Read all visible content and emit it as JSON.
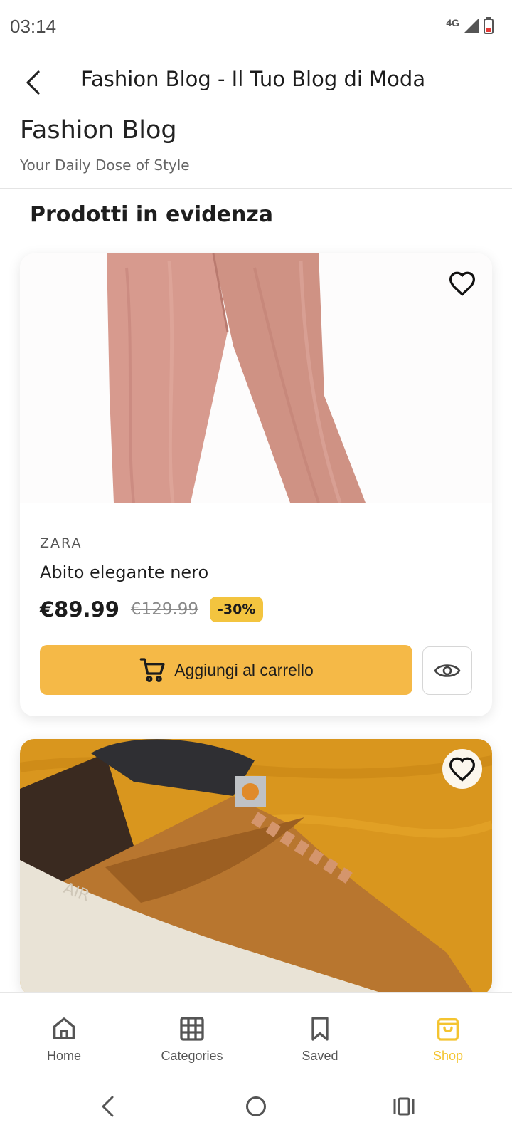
{
  "status_bar": {
    "time": "03:14",
    "network": "4G"
  },
  "app_bar": {
    "title": "Fashion Blog - Il Tuo Blog di Moda"
  },
  "blog": {
    "title": "Fashion Blog",
    "subtitle": "Your Daily Dose of Style"
  },
  "section": {
    "title": "Prodotti in evidenza"
  },
  "products": [
    {
      "brand": "ZARA",
      "name": "Abito elegante nero",
      "price": "€89.99",
      "old_price": "€129.99",
      "discount": "-30%",
      "add_to_cart_label": "Aggiungi al carrello"
    }
  ],
  "bottom_nav": {
    "items": [
      {
        "label": "Home",
        "icon": "home-icon"
      },
      {
        "label": "Categories",
        "icon": "grid-icon"
      },
      {
        "label": "Saved",
        "icon": "bookmark-icon"
      },
      {
        "label": "Shop",
        "icon": "shopping-bag-icon"
      }
    ],
    "active": "Shop"
  },
  "colors": {
    "accent": "#f4c430",
    "cart_button": "#f5b947",
    "discount_badge": "#f3c43f"
  }
}
